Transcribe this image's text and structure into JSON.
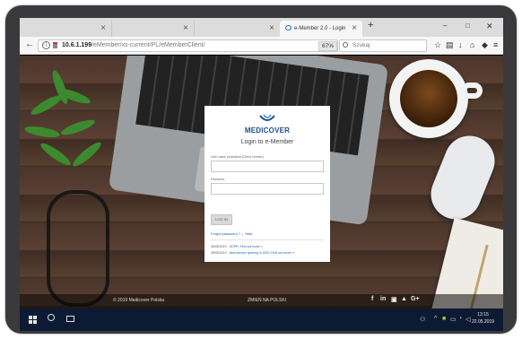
{
  "browser": {
    "tabs": [
      {
        "label": ""
      },
      {
        "label": ""
      },
      {
        "label": ""
      },
      {
        "label": "e-Member 2.0 - Login",
        "active": true
      }
    ],
    "new_tab_label": "+",
    "window_controls": {
      "minimize": "–",
      "maximize": "□",
      "close": "✕"
    },
    "url": {
      "host": "10.6.1.199",
      "path": "/eMember/xs-current/PL/eMemberClient/"
    },
    "zoom": "67%",
    "search_placeholder": "Szukaj",
    "toolbar_icons": [
      "star-icon",
      "reading-list-icon",
      "download-icon",
      "home-icon",
      "pocket-icon",
      "menu-icon"
    ]
  },
  "login": {
    "brand": "MEDICOVER",
    "title": "Login to e-Member",
    "username_label": "User name (individual (Client number)",
    "password_label": "Password",
    "login_button": "LOG IN",
    "forgot_link": "Forgot password ?",
    "help_link": "Help",
    "news": [
      {
        "date": "28/05/2019",
        "text": "GDPR. Find out more! »"
      },
      {
        "date": "28/05/2019",
        "text": "New service opening in 2019. Find out more! »"
      }
    ]
  },
  "footer": {
    "copyright": "© 2019 Medicover Polska",
    "language": "ZMIEŃ NA POLSKI",
    "social": [
      "f",
      "in",
      "▣",
      "▲",
      "G+"
    ]
  },
  "taskbar": {
    "time": "13:15",
    "date": "22.05.2019"
  },
  "colors": {
    "brand_blue": "#1a4e8f",
    "link_blue": "#1a5fb4",
    "taskbar": "#0d1a33"
  }
}
